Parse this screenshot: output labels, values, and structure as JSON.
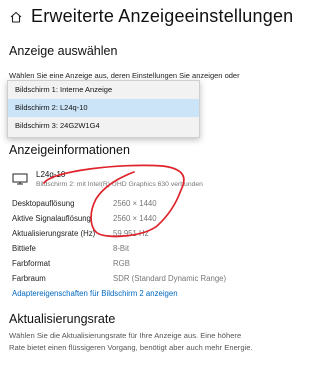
{
  "header": {
    "title": "Erweiterte Anzeigeeinstellungen",
    "home_icon": "home-icon"
  },
  "select_section": {
    "heading": "Anzeige auswählen",
    "description_partial": "Wählen Sie eine Anzeige aus, deren Einstellungen Sie anzeigen oder",
    "dropdown": {
      "items": [
        "Bildschirm 1: Interne Anzeige",
        "Bildschirm 2: L24q-10",
        "Bildschirm 3: 24G2W1G4"
      ],
      "selected_index": 1
    }
  },
  "info_section": {
    "heading": "Anzeigeinformationen",
    "monitor": {
      "icon": "monitor-icon",
      "name": "L24q-10",
      "description": "Bildschirm 2: mit Intel(R) UHD Graphics 630 verbunden"
    },
    "properties": [
      {
        "label": "Desktopauflösung",
        "value": "2560 × 1440"
      },
      {
        "label": "Aktive Signalauflösung",
        "value": "2560 × 1440"
      },
      {
        "label": "Aktualisierungsrate (Hz)",
        "value": "59,951 Hz"
      },
      {
        "label": "Bittiefe",
        "value": "8-Bit"
      },
      {
        "label": "Farbformat",
        "value": "RGB"
      },
      {
        "label": "Farbraum",
        "value": "SDR (Standard Dynamic Range)"
      }
    ],
    "adapter_link": "Adaptereigenschaften für Bildschirm 2 anzeigen"
  },
  "refresh_section": {
    "heading": "Aktualisierungsrate",
    "description_line1": "Wählen Sie die Aktualisierungsrate für Ihre Anzeige aus. Eine höhere",
    "description_line2": "Rate bietet einen flüssigeren Vorgang, benötigt aber auch mehr Energie."
  },
  "annotation": {
    "color": "#e0232b",
    "shape": "hand-drawn-circle"
  },
  "colors": {
    "accent": "#0067c0",
    "dropdown_selected": "#cce4f7"
  }
}
